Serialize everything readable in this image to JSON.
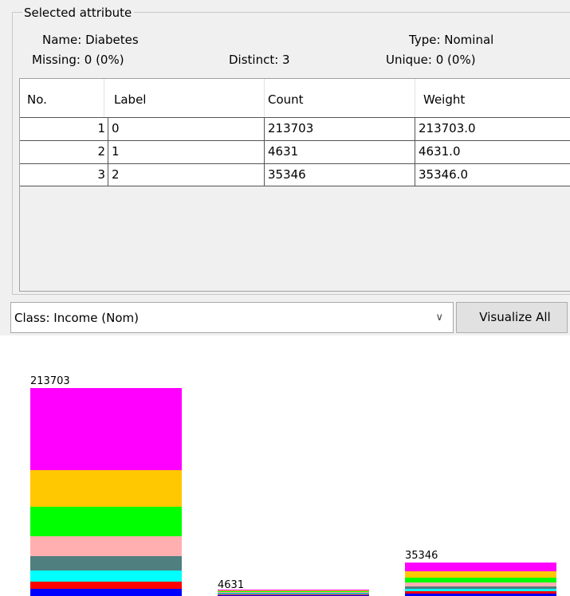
{
  "group": {
    "title": "Selected attribute",
    "name_text": "Name: Diabetes",
    "missing_text": "Missing: 0 (0%)",
    "distinct_text": "Distinct: 3",
    "type_text": "Type: Nominal",
    "unique_text": "Unique: 0 (0%)"
  },
  "table": {
    "headers": [
      "No.",
      "Label",
      "Count",
      "Weight"
    ],
    "rows": [
      {
        "no": "1",
        "label": "0",
        "count": "213703",
        "weight": "213703.0"
      },
      {
        "no": "2",
        "label": "1",
        "count": "4631",
        "weight": "4631.0"
      },
      {
        "no": "3",
        "label": "2",
        "count": "35346",
        "weight": "35346.0"
      }
    ]
  },
  "class_select": {
    "value": "Class: Income (Nom)",
    "chevron_icon": "chevron-down-icon"
  },
  "visualize_button": {
    "label": "Visualize All"
  },
  "chart_data": {
    "type": "bar",
    "stacked": true,
    "categories": [
      "0",
      "1",
      "2"
    ],
    "values": [
      213703,
      4631,
      35346
    ],
    "value_labels": [
      "213703",
      "4631",
      "35346"
    ],
    "segment_colors": [
      "#0000ff",
      "#ff0000",
      "#00ffff",
      "#4f7f7f",
      "#ffafaf",
      "#00ff00",
      "#ffc800",
      "#ff00ff"
    ]
  }
}
